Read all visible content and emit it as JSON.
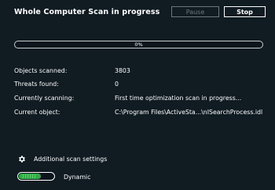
{
  "header": {
    "title": "Whole Computer Scan in progress",
    "pause_label": "Pause",
    "stop_label": "Stop"
  },
  "progress": {
    "value": 0,
    "label": "0%"
  },
  "info": [
    {
      "label": "Objects scanned:",
      "value": "3803"
    },
    {
      "label": "Threats found:",
      "value": "0"
    },
    {
      "label": "Currently scanning:",
      "value": "First time optimization scan in progress..."
    },
    {
      "label": "Current object:",
      "value": "C:\\Program Files\\ActiveSta...\\nISearchProcess.idl"
    }
  ],
  "settings": {
    "label": "Additional scan settings",
    "icon": "gear-icon"
  },
  "mode_toggle": {
    "label": "Dynamic",
    "enabled": true
  },
  "colors": {
    "background": "#101b22",
    "accent": "#2fae45",
    "disabled": "#6d777c"
  }
}
